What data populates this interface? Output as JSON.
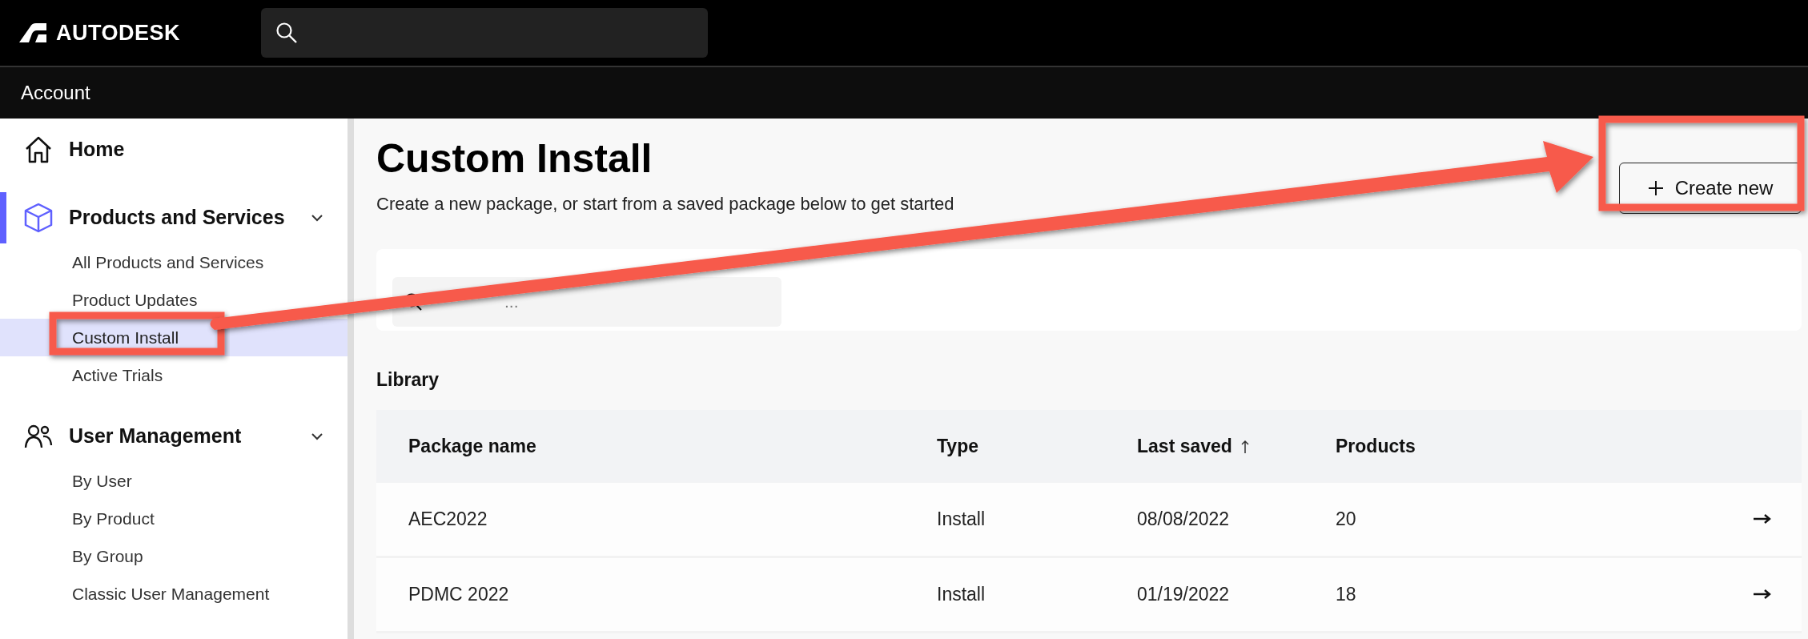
{
  "header": {
    "brand": "AUTODESK"
  },
  "subheader": {
    "title": "Account"
  },
  "sidebar": {
    "sections": [
      {
        "label": "Home",
        "selected": false
      },
      {
        "label": "Products and Services",
        "selected": true,
        "expanded": true,
        "items": [
          {
            "label": "All Products and Services",
            "selected": false
          },
          {
            "label": "Product Updates",
            "selected": false
          },
          {
            "label": "Custom Install",
            "selected": true
          },
          {
            "label": "Active Trials",
            "selected": false
          }
        ]
      },
      {
        "label": "User Management",
        "selected": false,
        "expanded": true,
        "items": [
          {
            "label": "By User",
            "selected": false
          },
          {
            "label": "By Product",
            "selected": false
          },
          {
            "label": "By Group",
            "selected": false
          },
          {
            "label": "Classic User Management",
            "selected": false
          }
        ]
      }
    ]
  },
  "page": {
    "title": "Custom Install",
    "subtitle": "Create a new package, or start from a saved package below to get started",
    "create_button": "Create new",
    "search": {
      "placeholder": "..."
    },
    "library": {
      "heading": "Library",
      "columns": [
        {
          "label": "Package name",
          "sorted": false
        },
        {
          "label": "Type",
          "sorted": false
        },
        {
          "label": "Last saved",
          "sorted": true
        },
        {
          "label": "Products",
          "sorted": false
        }
      ],
      "rows": [
        {
          "cells": [
            "AEC2022",
            "Install",
            "08/08/2022",
            "20"
          ]
        },
        {
          "cells": [
            "PDMC 2022",
            "Install",
            "01/19/2022",
            "18"
          ]
        }
      ]
    }
  }
}
